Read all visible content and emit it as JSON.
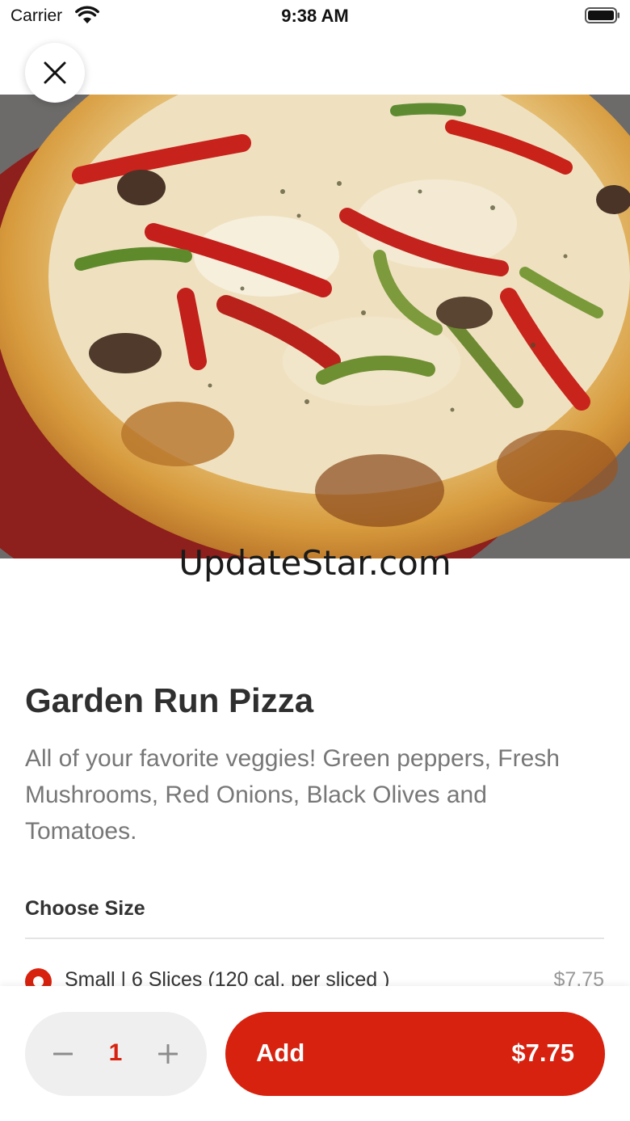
{
  "status_bar": {
    "carrier": "Carrier",
    "time": "9:38 AM",
    "wifi_icon": "wifi-icon",
    "battery_icon": "battery-full-icon"
  },
  "close_icon": "close-icon",
  "hero_image": "pizza-photo",
  "watermark": "UpdateStar.com",
  "product": {
    "title": "Garden Run Pizza",
    "description": "All of your favorite veggies! Green peppers, Fresh Mushrooms, Red Onions, Black Olives and Tomatoes."
  },
  "size_section": {
    "title": "Choose Size",
    "options": [
      {
        "label": "Small | 6 Slices (120 cal. per sliced )",
        "price": "$7.75",
        "selected": true
      }
    ]
  },
  "footer": {
    "quantity": "1",
    "minus_icon": "minus-icon",
    "plus_icon": "plus-icon",
    "add_label": "Add",
    "add_price": "$7.75"
  },
  "colors": {
    "accent": "#d7220f",
    "stepper_bg": "#efefef",
    "title_text": "#2f2f2f",
    "body_text": "#777777"
  }
}
